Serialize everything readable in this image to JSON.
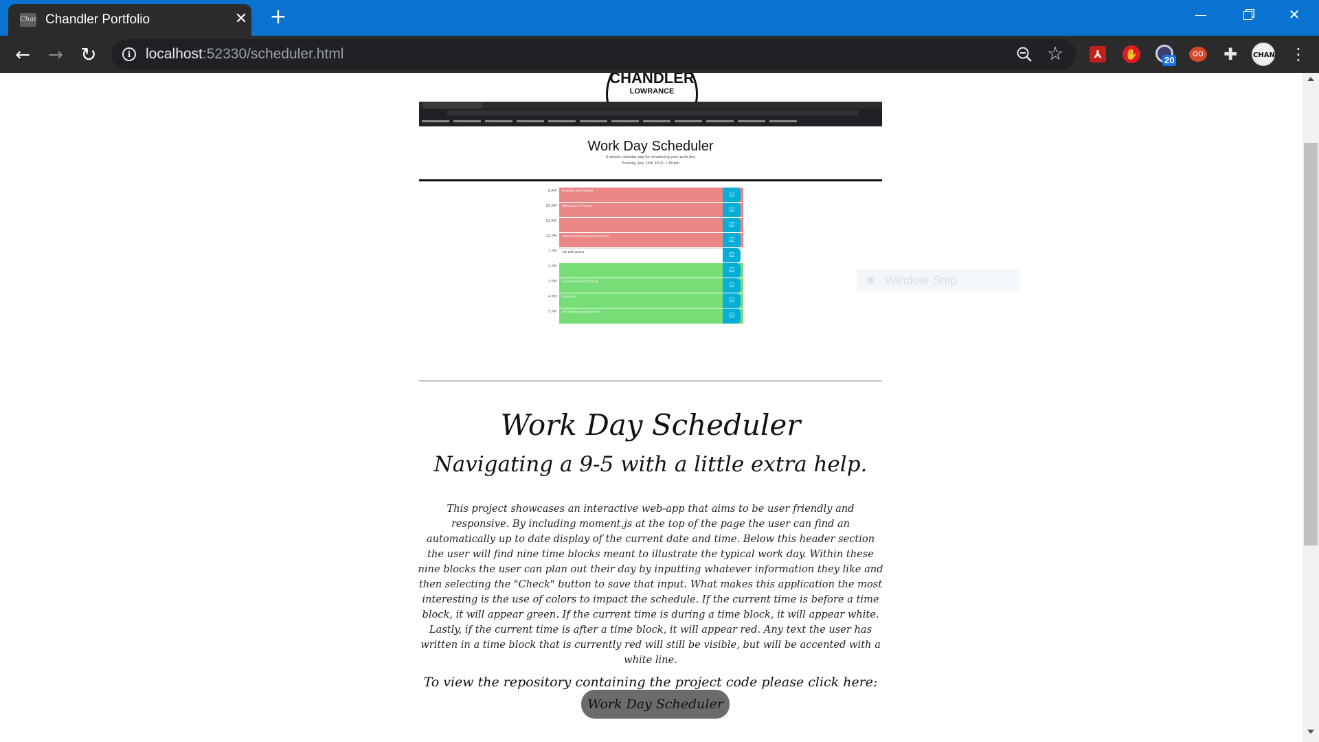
{
  "browser": {
    "tab": {
      "favicon_text": "Chan",
      "title": "Chandler Portfolio"
    },
    "url": {
      "host": "localhost",
      "rest": ":52330/scheduler.html"
    },
    "extensions": {
      "badge_count": "20"
    },
    "avatar_text": "CHAN"
  },
  "logo": {
    "name": "CHANDLER",
    "sub": "LOWRANCE"
  },
  "screenshot": {
    "title": "Work Day Scheduler",
    "subtitle": "A simple calendar app for scheduling your work day",
    "date": "Tuesday, July 14th 2020, 1:18 pm",
    "rows": [
      {
        "hour": "9 AM",
        "state": "past",
        "note": "Breakfast with Mikaela"
      },
      {
        "hour": "10 AM",
        "state": "past",
        "note": "Workout @ LA Fitness"
      },
      {
        "hour": "11 AM",
        "state": "past",
        "note": ""
      },
      {
        "hour": "12 PM",
        "state": "past",
        "note": "Submit remaining weekly projects"
      },
      {
        "hour": "1 PM",
        "state": "present",
        "note": "Call with Lorena"
      },
      {
        "hour": "2 PM",
        "state": "future",
        "note": ""
      },
      {
        "hour": "3 PM",
        "state": "future",
        "note": "In-person product training"
      },
      {
        "hour": "4 PM",
        "state": "future",
        "note": "Commute"
      },
      {
        "hour": "5 PM",
        "state": "future",
        "note": "Vet Radiology appointment"
      }
    ]
  },
  "snip": {
    "label": "Window Snip"
  },
  "project": {
    "title": "Work Day Scheduler",
    "subtitle": "Navigating a 9-5 with a little extra help.",
    "description": "This project showcases an interactive web-app that aims to be user friendly and responsive. By including moment.js at the top of the page the user can find an automatically up to date display of the current date and time. Below this header section the user will find nine time blocks meant to illustrate the typical work day. Within these nine blocks the user can plan out their day by inputting whatever information they like and then selecting the \"Check\" button to save that input. What makes this application the most interesting is the use of colors to impact the schedule. If the current time is before a time block, it will appear green. If the current time is during a time block, it will appear white. Lastly, if the current time is after a time block, it will appear red. Any text the user has written in a time block that is currently red will still be visible, but will be accented with a white line.",
    "repo_text": "To view the repository containing the project code please click here:",
    "repo_button": "Work Day Scheduler"
  },
  "colors": {
    "titlebar": "#0a73d1",
    "past": "#ea8685",
    "present": "#ffffff",
    "future": "#77dd77",
    "save": "#06aed5",
    "repo_button": "#6b6b6b"
  }
}
